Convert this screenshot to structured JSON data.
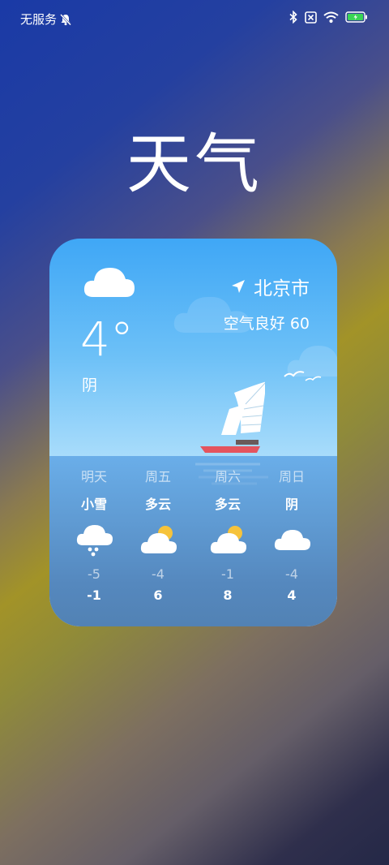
{
  "status_bar": {
    "carrier": "无服务",
    "icons": [
      "mute-icon",
      "bluetooth-icon",
      "no-sim-icon",
      "wifi-icon",
      "battery-charging-icon"
    ]
  },
  "app": {
    "title": "天气"
  },
  "widget": {
    "current_temp": "4°",
    "condition": "阴",
    "location": "北京市",
    "air_quality": "空气良好 60",
    "forecast": [
      {
        "day": "明天",
        "condition": "小雪",
        "icon": "snow-cloud-icon",
        "low": "-5",
        "high": "-1"
      },
      {
        "day": "周五",
        "condition": "多云",
        "icon": "partly-cloudy-icon",
        "low": "-4",
        "high": "6"
      },
      {
        "day": "周六",
        "condition": "多云",
        "icon": "partly-cloudy-icon",
        "low": "-1",
        "high": "8"
      },
      {
        "day": "周日",
        "condition": "阴",
        "icon": "cloudy-icon",
        "low": "-4",
        "high": "4"
      }
    ]
  },
  "colors": {
    "sun": "#f6c33b",
    "boat_hull": "#e4545e",
    "sail": "#ffffff"
  }
}
